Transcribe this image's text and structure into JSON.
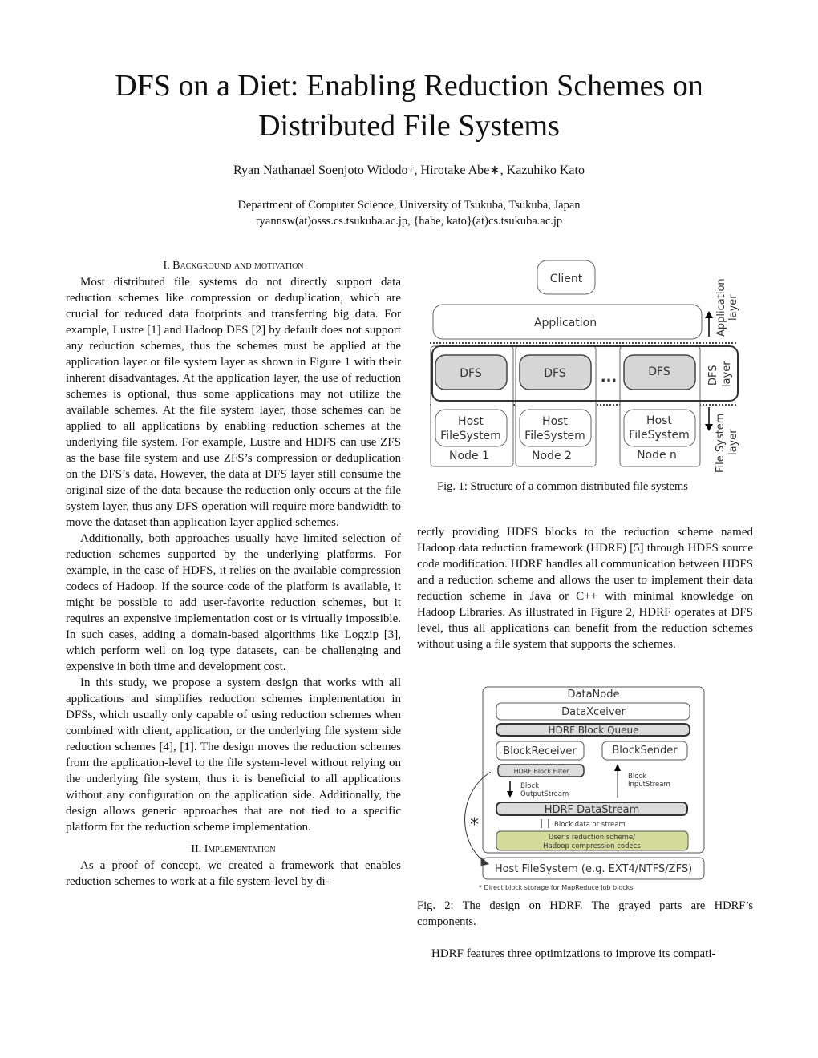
{
  "title": "DFS on a Diet: Enabling Reduction Schemes on Distributed File Systems",
  "authors": "Ryan Nathanael Soenjoto Widodo†, Hirotake Abe∗, Kazuhiko Kato",
  "affiliation": "Department of Computer Science, University of Tsukuba, Tsukuba, Japan",
  "emails": "ryannsw(at)osss.cs.tsukuba.ac.jp, {habe, kato}(at)cs.tsukuba.ac.jp",
  "sections": {
    "s1": {
      "num": "I.",
      "title": "Background and motivation",
      "paragraphs": [
        "Most distributed file systems do not directly support data reduction schemes like compression or deduplication, which are crucial for reduced data footprints and transferring big data. For example, Lustre [1] and Hadoop DFS [2] by default does not support any reduction schemes, thus the schemes must be applied at the application layer or file system layer as shown in Figure 1 with their inherent disadvantages. At the application layer, the use of reduction schemes is optional, thus some applications may not utilize the available schemes. At the file system layer, those schemes can be applied to all applications by enabling reduction schemes at the underlying file system. For example, Lustre and HDFS can use ZFS as the base file system and use ZFS’s compression or deduplication on the DFS’s data. However, the data at DFS layer still consume the original size of the data because the reduction only occurs at the file system layer, thus any DFS operation will require more bandwidth to move the dataset than application layer applied schemes.",
        "Additionally, both approaches usually have limited selection of reduction schemes supported by the underlying platforms. For example, in the case of HDFS, it relies on the available compression codecs of Hadoop. If the source code of the platform is available, it might be possible to add user-favorite reduction schemes, but it requires an expensive implementation cost or is virtually impossible. In such cases, adding a domain-based algorithms like Logzip [3], which perform well on log type datasets, can be challenging and expensive in both time and development cost.",
        "In this study, we propose a system design that works with all applications and simplifies reduction schemes implementation in DFSs, which usually only capable of using reduction schemes when combined with client, application, or the underlying file system side reduction schemes [4], [1]. The design moves the reduction schemes from the application-level to the file system-level without relying on the underlying file system, thus it is beneficial to all applications without any configuration on the application side. Additionally, the design allows generic approaches that are not tied to a specific platform for the reduction scheme implementation."
      ]
    },
    "s2": {
      "num": "II.",
      "title": "Implementation",
      "paragraphs": [
        "As a proof of concept, we created a framework that enables reduction schemes to work at a file system-level by di-"
      ]
    },
    "right_par1": "rectly providing HDFS blocks to the reduction scheme named Hadoop data reduction framework (HDRF) [5] through HDFS source code modification. HDRF handles all communication between HDFS and a reduction scheme and allows the user to implement their data reduction scheme in Java or C++ with minimal knowledge on Hadoop Libraries. As illustrated in Figure 2, HDRF operates at DFS level, thus all applications can benefit from the reduction schemes without using a file system that supports the schemes.",
    "right_par2": "HDRF features three optimizations to improve its compati-"
  },
  "fig1": {
    "caption": "Fig. 1: Structure of a common distributed file systems",
    "client": "Client",
    "application": "Application",
    "dfs": [
      "DFS",
      "DFS",
      "DFS"
    ],
    "ellipsis": "...",
    "host": [
      "Host",
      "FileSystem"
    ],
    "nodes": [
      "Node 1",
      "Node 2",
      "Node n"
    ],
    "layers": {
      "app": [
        "Application",
        "layer"
      ],
      "dfs": [
        "DFS",
        "layer"
      ],
      "fs": [
        "File System",
        "layer"
      ]
    }
  },
  "fig2": {
    "caption": "Fig. 2: The design on HDRF. The grayed parts are HDRF’s components.",
    "datanode": "DataNode",
    "dataxceiver": "DataXceiver",
    "queue": "HDRF Block Queue",
    "receiver": "BlockReceiver",
    "sender": "BlockSender",
    "filter": "HDRF Block Filter",
    "out": [
      "Block",
      "OutputStream"
    ],
    "in": [
      "Block",
      "InputStream"
    ],
    "datastream": "HDRF DataStream",
    "blockdata": "Block data or stream",
    "scheme": [
      "User's reduction scheme/",
      "Hadoop compression codecs"
    ],
    "hostfs": "Host FileSystem (e.g. EXT4/NTFS/ZFS)",
    "asterisk": "*",
    "footnote": "* Direct block storage for MapReduce job blocks",
    "colors": {
      "gray": "#dcdcdc",
      "green": "#d4dc9c"
    }
  }
}
